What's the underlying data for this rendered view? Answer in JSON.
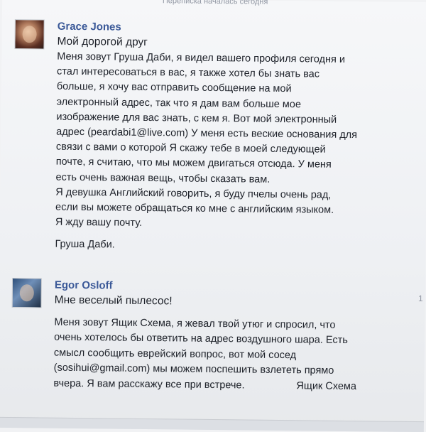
{
  "conversation": {
    "header": "Переписка началась сегодня"
  },
  "messages": [
    {
      "author": "Grace Jones",
      "greeting": "Мой дорогой друг",
      "lines": [
        "Меня зовут Груша Даби, я видел вашего профиля сегодня и",
        "стал интересоваться в вас, я также хотел бы знать вас",
        "больше, я хочу вас отправить сообщение на мой",
        "электронный адрес, так что я дам вам больше мое",
        "изображение для вас знать, с кем я. Вот мой электронный",
        "адрес (peardabi1@live.com) У меня есть веские основания для",
        "связи с вами о которой Я скажу тебе в моей следующей",
        "почте, я считаю, что мы можем двигаться отсюда. У меня",
        "есть очень важная вещь, чтобы сказать вам.",
        "Я девушка Английский говорить, я буду пчелы очень рад,",
        "если вы можете обращаться ко мне с английским языком.",
        "Я жду вашу почту."
      ],
      "signature": "Груша Даби."
    },
    {
      "author": "Egor Osloff",
      "greeting": "Мне веселый пылесос!",
      "lines": [
        "Меня зовут Ящик Схема, я жевал твой утюг и спросил, что",
        "очень хотелось бы ответить на адрес воздушного шара. Есть",
        "смысл сообщить еврейский вопрос, вот мой сосед",
        "(sosihui@gmail.com) мы можем поспешить взлететь прямо",
        "вчера. Я вам расскажу все при встрече."
      ],
      "signature": "Ящик Схема"
    }
  ],
  "edge_mark": "1",
  "colors": {
    "author_link": "#3b5998",
    "text": "#1d2129",
    "background": "#f1f2f4"
  }
}
